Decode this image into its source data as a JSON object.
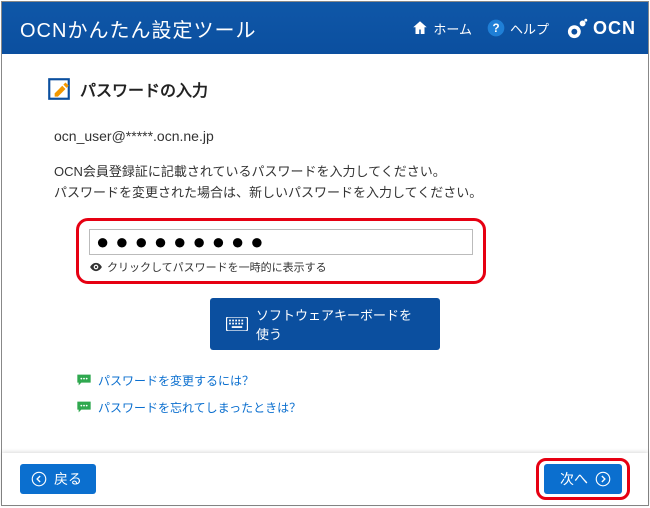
{
  "header": {
    "app_title": "OCNかんたん設定ツール",
    "home_label": "ホーム",
    "help_label": "ヘルプ",
    "brand": "OCN"
  },
  "section": {
    "title": "パスワードの入力",
    "email": "ocn_user@*****.ocn.ne.jp",
    "instruction_line1": "OCN会員登録証に記載されているパスワードを入力してください。",
    "instruction_line2": "パスワードを変更された場合は、新しいパスワードを入力してください。"
  },
  "password": {
    "value": "●●●●●●●●●",
    "reveal_label": "クリックしてパスワードを一時的に表示する"
  },
  "keyboard_button": "ソフトウェアキーボードを使う",
  "help_links": {
    "change_pw": "パスワードを変更するには？",
    "forgot_pw": "パスワードを忘れてしまったときは？"
  },
  "footer": {
    "back": "戻る",
    "next": "次へ"
  }
}
